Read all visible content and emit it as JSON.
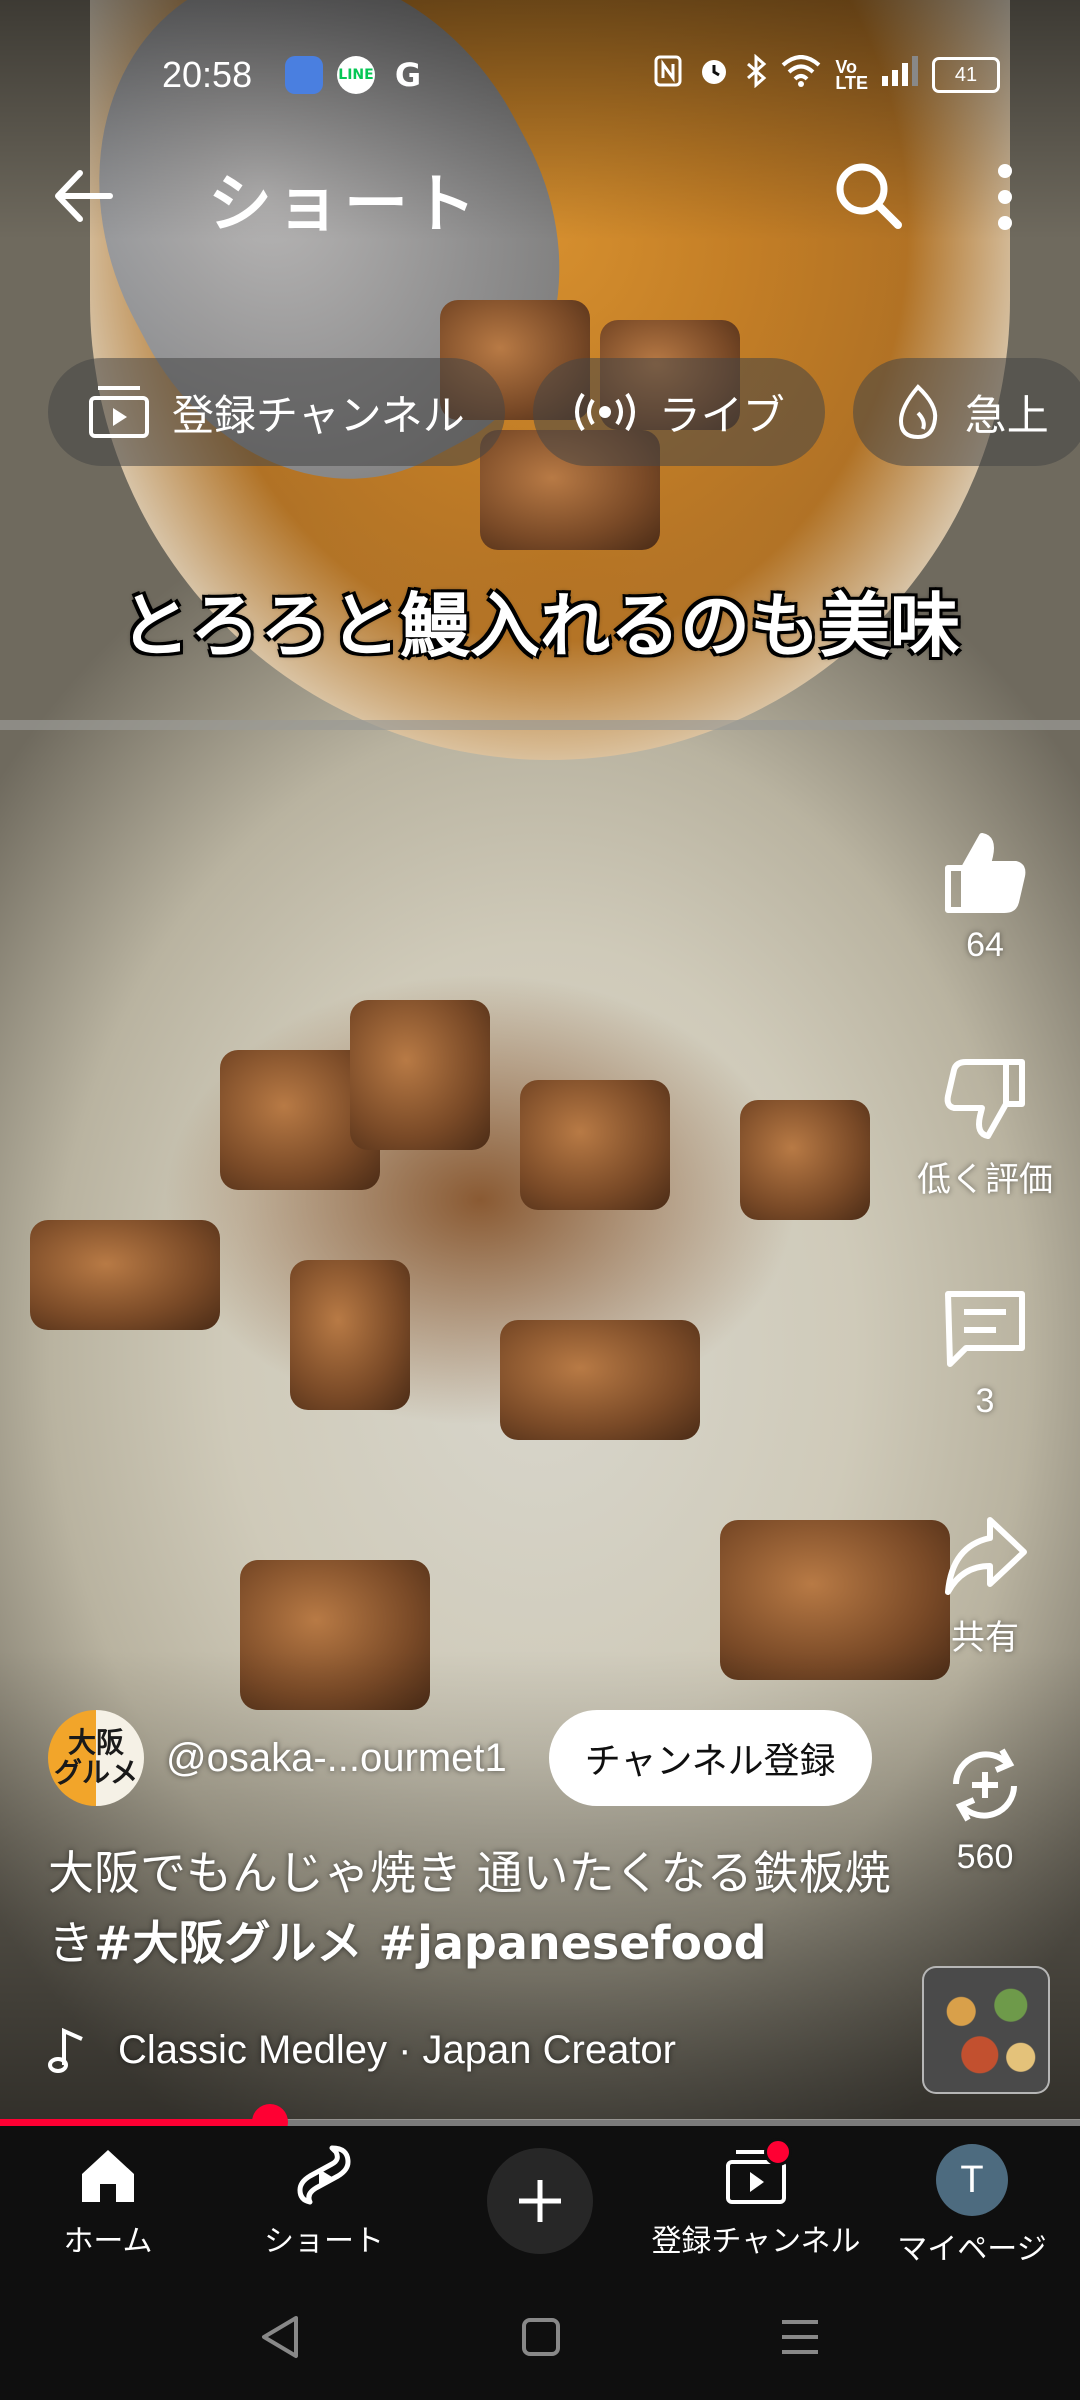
{
  "status_bar": {
    "time": "20:58",
    "battery": "41",
    "apps": [
      "app-icon",
      "LINE",
      "G"
    ]
  },
  "header": {
    "title": "ショート"
  },
  "chips": [
    {
      "label": "登録チャンネル",
      "icon": "subscriptions-icon"
    },
    {
      "label": "ライブ",
      "icon": "live-icon"
    },
    {
      "label": "急上",
      "icon": "trending-icon"
    }
  ],
  "video": {
    "overlay_caption": "とろろと鰻入れるのも美味"
  },
  "actions": {
    "like_count": "64",
    "dislike_label": "低く評価",
    "comment_count": "3",
    "share_label": "共有",
    "remix_count": "560"
  },
  "channel": {
    "avatar_text": "大阪\nグルメ",
    "handle": "@osaka-...ourmet1",
    "subscribe_label": "チャンネル登録"
  },
  "description": {
    "text": "大阪でもんじゃ焼き 通いたくなる鉄板焼き",
    "tags": "#大阪グルメ #japanesefood"
  },
  "music": {
    "text": "Classic Medley · Japan Creator"
  },
  "progress": {
    "fraction": 0.25
  },
  "bottom_nav": {
    "home": "ホーム",
    "shorts": "ショート",
    "subscriptions": "登録チャンネル",
    "me": "マイページ",
    "me_initial": "T"
  },
  "colors": {
    "accent": "#ff0033",
    "nav_background": "#0f0f0f"
  }
}
